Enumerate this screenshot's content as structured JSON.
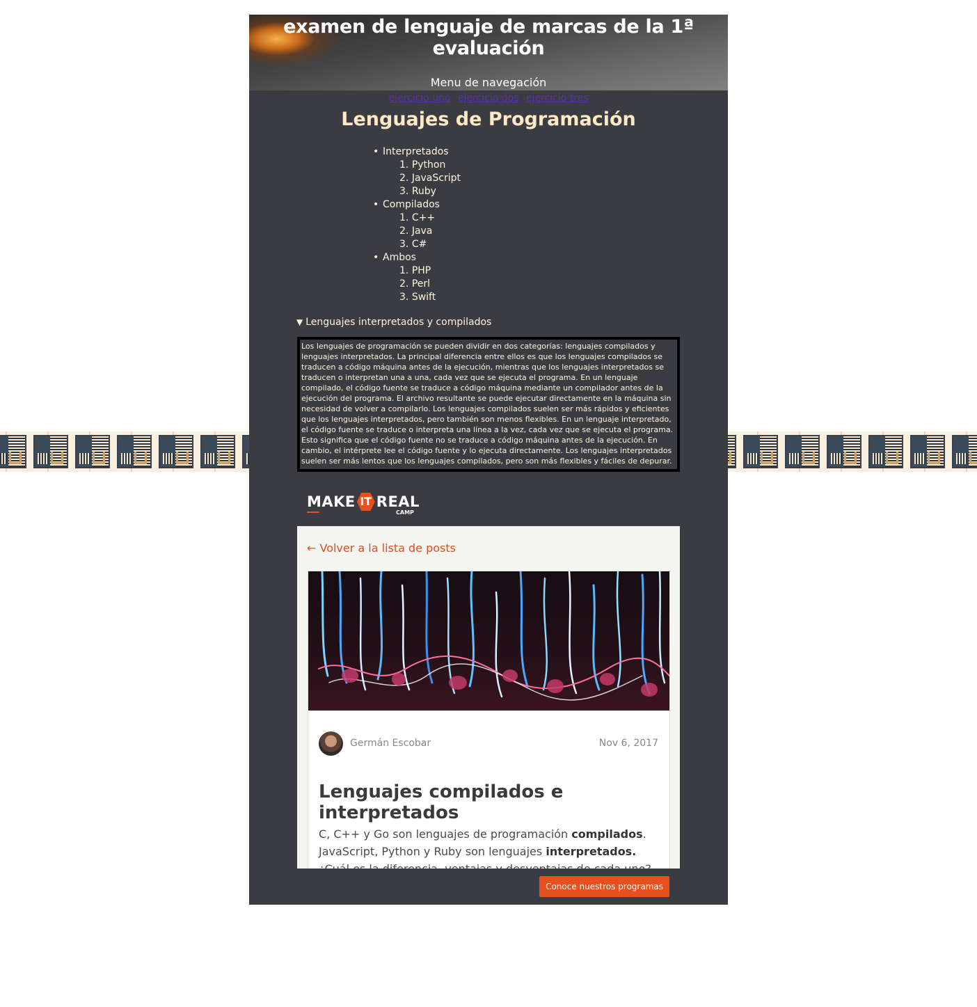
{
  "header": {
    "title": "examen de lenguaje de marcas de la 1ª evaluación",
    "nav_title": "Menu de navegación",
    "nav_links": [
      "ejercicio uno",
      "ejercicio dos",
      "ejercicio tres"
    ]
  },
  "main": {
    "title": "Lenguajes de Programación",
    "groups": [
      {
        "label": "Interpretados",
        "items": [
          "Python",
          "JavaScript",
          "Ruby"
        ]
      },
      {
        "label": "Compilados",
        "items": [
          "C++",
          "Java",
          "C#"
        ]
      },
      {
        "label": "Ambos",
        "items": [
          "PHP",
          "Perl",
          "Swift"
        ]
      }
    ],
    "details_summary": "Lenguajes interpretados y compilados",
    "details_text": "Los lenguajes de programación se pueden dividir en dos categorías: lenguajes compilados y lenguajes interpretados. La principal diferencia entre ellos es que los lenguajes compilados se traducen a código máquina antes de la ejecución, mientras que los lenguajes interpretados se traducen o interpretan una a una, cada vez que se ejecuta el programa. En un lenguaje compilado, el código fuente se traduce a código máquina mediante un compilador antes de la ejecución del programa. El archivo resultante se puede ejecutar directamente en la máquina sin necesidad de volver a compilarlo. Los lenguajes compilados suelen ser más rápidos y eficientes que los lenguajes interpretados, pero también son menos flexibles. En un lenguaje interpretado, el código fuente se traduce o interpreta una línea a la vez, cada vez que se ejecuta el programa. Esto significa que el código fuente no se traduce a código máquina antes de la ejecución. En cambio, el intérprete lee el código fuente y lo ejecuta directamente. Los lenguajes interpretados suelen ser más lentos que los lenguajes compilados, pero son más flexibles y fáciles de depurar."
  },
  "embed": {
    "logo": {
      "make": "MAKE",
      "it": "IT",
      "real": "REAL",
      "camp": "CAMP"
    },
    "back_link": "← Volver a la lista de posts",
    "author": "Germán Escobar",
    "date": "Nov 6, 2017",
    "post_title": "Lenguajes compilados e interpretados",
    "excerpt": {
      "part1": "C, C++ y Go son lenguajes de programación ",
      "bold1": "compilados",
      "part2": ". JavaScript, Python y Ruby son lenguajes ",
      "bold2": "interpretados.",
      "part3": " ¿Cuál es la diferencia, ventajas y desventajas de cada uno?"
    },
    "cta": "Conoce nuestros programas"
  },
  "colors": {
    "page_bg": "#3b3c41",
    "title_accent": "#ffe8c6",
    "link": "#5b2fa8",
    "brand_orange": "#e6501e"
  },
  "icons": {
    "details_marker": "triangle-down-icon",
    "logo_it": "hexagon-icon"
  }
}
